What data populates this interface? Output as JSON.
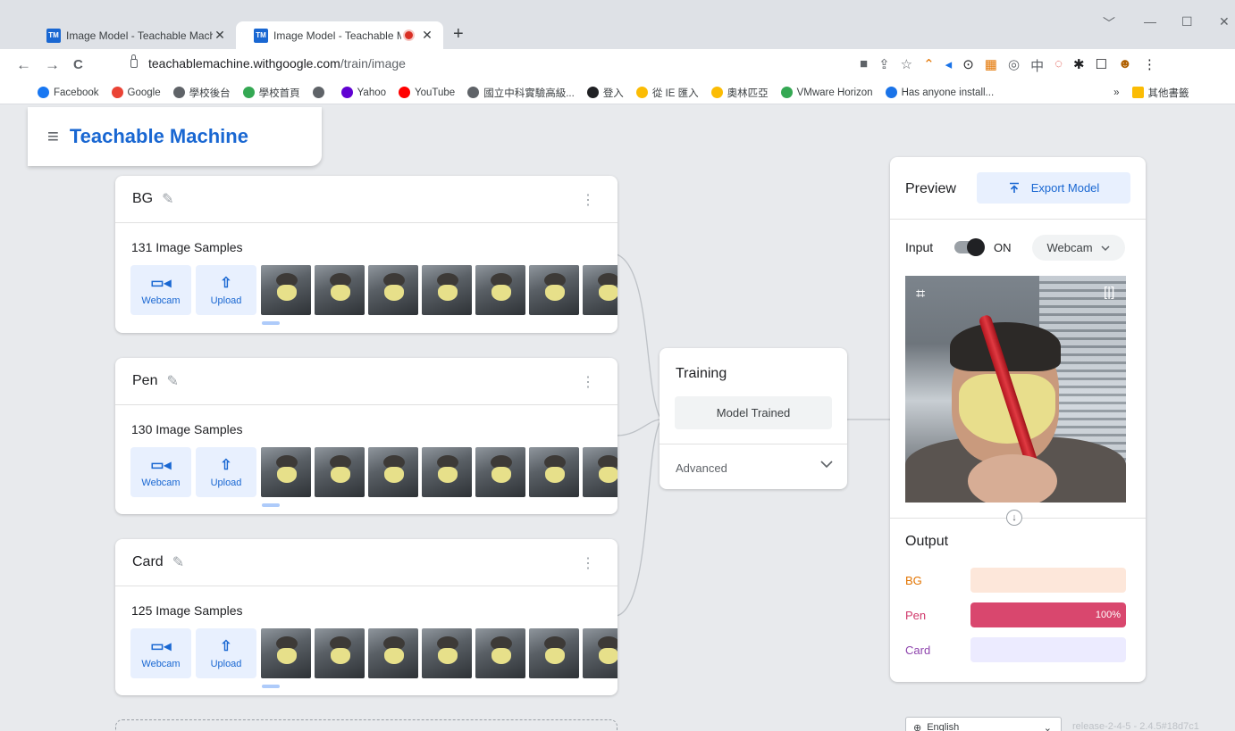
{
  "browser": {
    "tabs": [
      {
        "favicon": "TM",
        "title": "Image Model - Teachable Machi"
      },
      {
        "favicon": "TM",
        "title": "Image Model - Teachable M"
      }
    ],
    "new_tab": "+",
    "window_controls": [
      "﹀",
      "—",
      "☐",
      "✕"
    ],
    "nav": {
      "back": "←",
      "forward": "→",
      "reload": "C"
    },
    "url_host": "teachablemachine.withgoogle.com",
    "url_path": "/train/image",
    "toolbar_icons": [
      "camera-icon",
      "share-icon",
      "star-icon",
      "extension-icon",
      "profile-icon",
      "menu-icon"
    ],
    "toolbar_glyphs": [
      "■",
      "⇪",
      "☆",
      "⌃",
      "◂",
      "⊙",
      "▦",
      "◎",
      "中",
      "◌",
      "✱",
      "☐",
      "☻",
      "⋮"
    ],
    "bookmarks": [
      {
        "label": "Facebook",
        "color": "#1877f2"
      },
      {
        "label": "Google",
        "color": "#ea4335"
      },
      {
        "label": "學校後台",
        "color": "#5f6368"
      },
      {
        "label": "學校首頁",
        "color": "#34a853"
      },
      {
        "label": "",
        "color": "#5f6368"
      },
      {
        "label": "Yahoo",
        "color": "#6001d2"
      },
      {
        "label": "YouTube",
        "color": "#ff0000"
      },
      {
        "label": "國立中科實驗高級...",
        "color": "#5f6368"
      },
      {
        "label": "登入",
        "color": "#202124"
      },
      {
        "label": "從 IE 匯入",
        "color": "#fbbc04"
      },
      {
        "label": "奧林匹亞",
        "color": "#fbbc04"
      },
      {
        "label": "VMware Horizon",
        "color": "#34a853"
      },
      {
        "label": "Has anyone install...",
        "color": "#1a73e8"
      }
    ],
    "bookmarks_more": "»",
    "bookmarks_other": "其他書籤"
  },
  "app": {
    "menu_icon": "≡",
    "brand": "Teachable Machine"
  },
  "classes": [
    {
      "name": "BG",
      "samples": "131 Image Samples",
      "webcam": "Webcam",
      "upload": "Upload"
    },
    {
      "name": "Pen",
      "samples": "130 Image Samples",
      "webcam": "Webcam",
      "upload": "Upload"
    },
    {
      "name": "Card",
      "samples": "125 Image Samples",
      "webcam": "Webcam",
      "upload": "Upload"
    }
  ],
  "training": {
    "title": "Training",
    "button": "Model Trained",
    "advanced": "Advanced"
  },
  "preview": {
    "title": "Preview",
    "export": "Export Model",
    "input_label": "Input",
    "toggle_state": "ON",
    "source": "Webcam",
    "output_title": "Output",
    "outputs": [
      {
        "label": "BG",
        "color": "#e37400",
        "track": "#fde7da",
        "fill": "#f4a261",
        "value": 0,
        "pct_text": ""
      },
      {
        "label": "Pen",
        "color": "#d0376a",
        "track": "#f8d7e0",
        "fill": "#d9476e",
        "value": 1,
        "pct_text": "100%"
      },
      {
        "label": "Card",
        "color": "#8e44ad",
        "track": "#ecebff",
        "fill": "#8e7cc3",
        "value": 0,
        "pct_text": ""
      }
    ]
  },
  "footer": {
    "language": "English",
    "release": "release-2-4-5 - 2.4.5#18d7c1"
  }
}
